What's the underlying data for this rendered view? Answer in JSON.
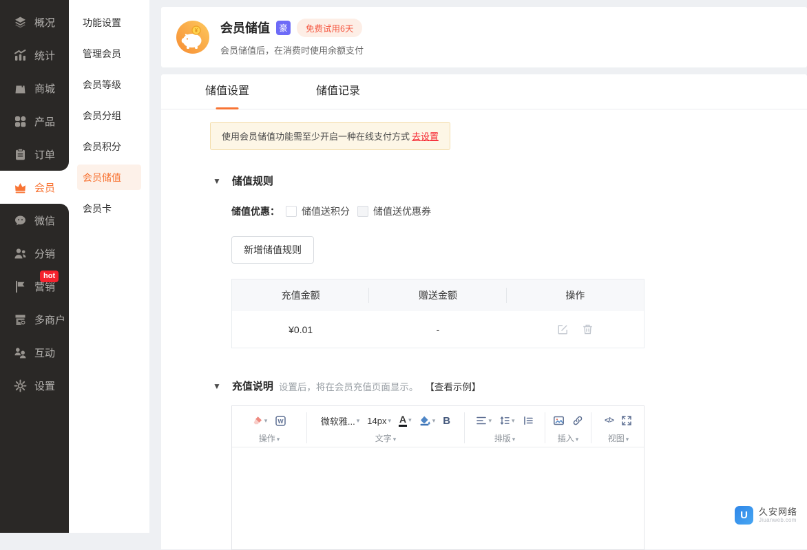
{
  "sidebar": {
    "items": [
      {
        "label": "概况",
        "icon": "layers-icon"
      },
      {
        "label": "统计",
        "icon": "stats-icon"
      },
      {
        "label": "商城",
        "icon": "mall-icon"
      },
      {
        "label": "产品",
        "icon": "product-icon"
      },
      {
        "label": "订单",
        "icon": "order-icon"
      },
      {
        "label": "会员",
        "icon": "member-crown-icon",
        "active": true
      },
      {
        "label": "微信",
        "icon": "wechat-icon"
      },
      {
        "label": "分销",
        "icon": "distribution-icon"
      },
      {
        "label": "营销",
        "icon": "marketing-flag-icon",
        "badge": "hot"
      },
      {
        "label": "多商户",
        "icon": "multi-store-icon"
      },
      {
        "label": "互动",
        "icon": "interaction-icon"
      },
      {
        "label": "设置",
        "icon": "settings-gear-icon"
      }
    ],
    "hot_badge": "hot"
  },
  "submenu": {
    "items": [
      {
        "label": "功能设置"
      },
      {
        "label": "管理会员"
      },
      {
        "label": "会员等级"
      },
      {
        "label": "会员分组"
      },
      {
        "label": "会员积分"
      },
      {
        "label": "会员储值",
        "active": true
      },
      {
        "label": "会员卡"
      }
    ]
  },
  "header": {
    "title": "会员储值",
    "edition_badge": "豪",
    "trial_badge": "免费试用6天",
    "subtitle": "会员储值后，在消费时使用余额支付"
  },
  "tabs": [
    {
      "label": "储值设置",
      "active": true
    },
    {
      "label": "储值记录",
      "active": false
    }
  ],
  "notice": {
    "text": "使用会员储值功能需至少开启一种在线支付方式",
    "link": "去设置"
  },
  "rules": {
    "title": "储值规则",
    "promo_label": "储值优惠：",
    "checkboxes": [
      {
        "label": "储值送积分",
        "checked": false
      },
      {
        "label": "储值送优惠券",
        "checked": false
      }
    ],
    "add_button": "新增储值规则",
    "table": {
      "headers": [
        "充值金额",
        "赠送金额",
        "操作"
      ],
      "rows": [
        {
          "recharge": "¥0.01",
          "gift": "-"
        }
      ]
    }
  },
  "note_section": {
    "title": "充值说明",
    "desc": "设置后，将在会员充值页面显示。",
    "example_link": "【查看示例】"
  },
  "editor": {
    "groups": [
      {
        "label": "操作"
      },
      {
        "label": "文字"
      },
      {
        "label": "排版"
      },
      {
        "label": "插入"
      },
      {
        "label": "视图"
      }
    ],
    "font_family": "微软雅...",
    "font_size": "14px",
    "code_text": "</>",
    "content": ""
  },
  "footer": {
    "logo_text": "久安网络",
    "logo_domain": "Jiuanweb.com"
  },
  "colors": {
    "accent": "#f87434",
    "sidebar_bg": "#2a2826",
    "hot_red": "#f5222d",
    "edition_badge_bg": "#6d6bf7",
    "submenu_active_bg": "#fdf1e9",
    "notice_bg": "#fdf6e6",
    "link_red": "#f5222d"
  }
}
